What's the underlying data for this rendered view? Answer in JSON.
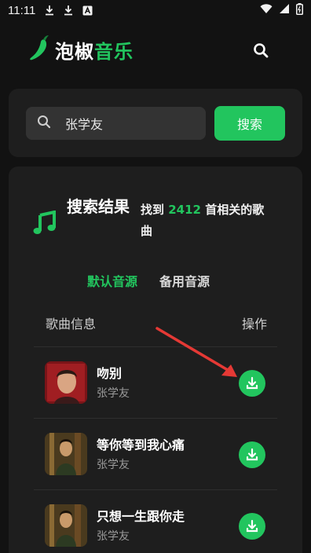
{
  "status_bar": {
    "time": "11:11"
  },
  "app": {
    "title_part1": "泡椒",
    "title_part2": "音乐"
  },
  "search": {
    "query": "张学友",
    "button_label": "搜索"
  },
  "results": {
    "title": "搜索结果",
    "count_prefix": "找到",
    "count": "2412",
    "count_suffix": "首相关的歌曲",
    "tabs": [
      {
        "label": "默认音源",
        "active": true
      },
      {
        "label": "备用音源",
        "active": false
      }
    ],
    "columns": {
      "info": "歌曲信息",
      "action": "操作"
    },
    "songs": [
      {
        "name": "吻别",
        "artist": "张学友"
      },
      {
        "name": "等你等到我心痛",
        "artist": "张学友"
      },
      {
        "name": "只想一生跟你走",
        "artist": "张学友"
      }
    ]
  },
  "colors": {
    "accent": "#22c55e",
    "background": "#121212",
    "card": "#1e1e1e"
  }
}
